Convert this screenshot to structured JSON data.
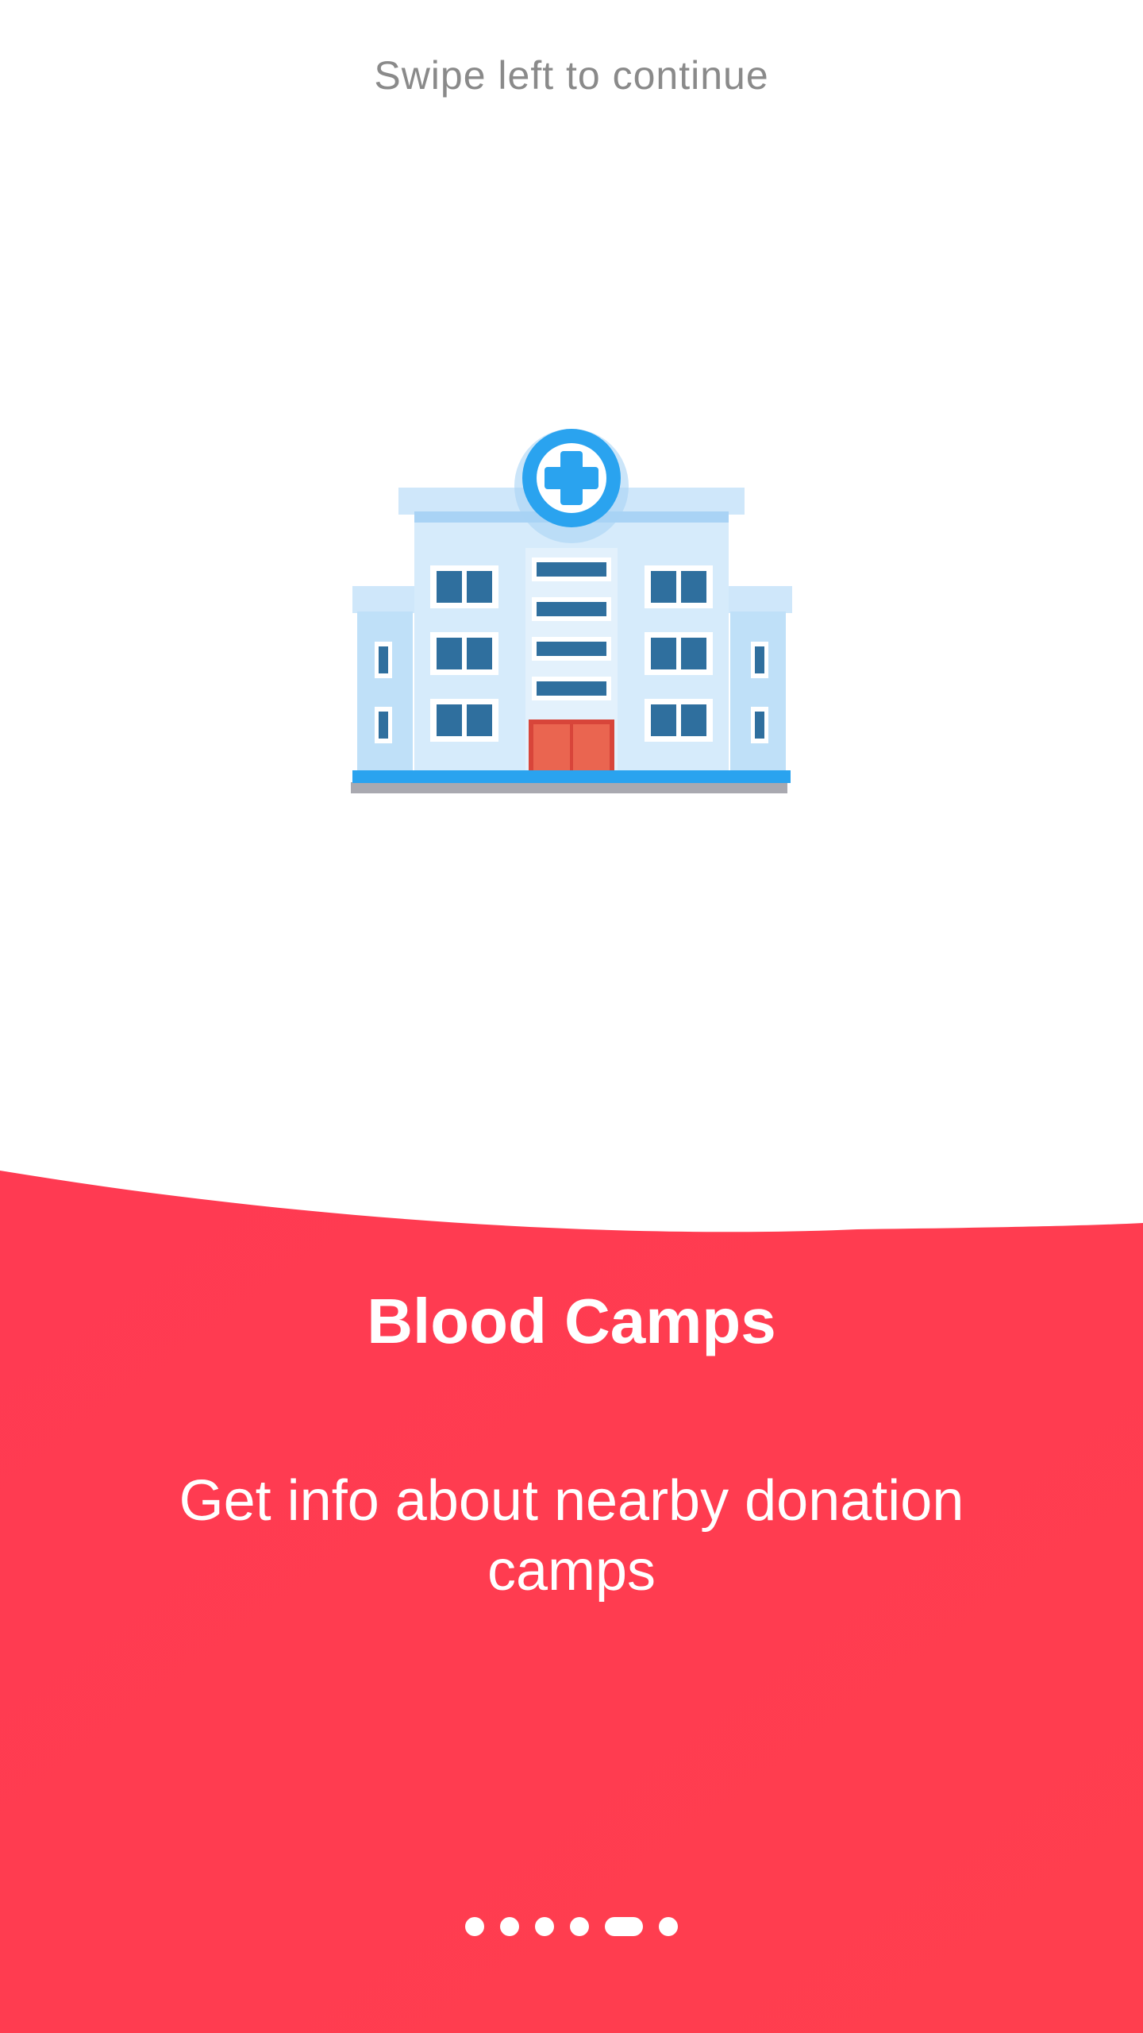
{
  "hint": "Swipe left to continue",
  "illustration_icon": "hospital-icon",
  "title": "Blood Camps",
  "subtitle": "Get info about nearby donation camps",
  "pager": {
    "total": 6,
    "active_index": 5
  },
  "colors": {
    "accent": "#FF3A52",
    "background": "#FFFFFF",
    "hint_text": "#8A8A8A"
  }
}
